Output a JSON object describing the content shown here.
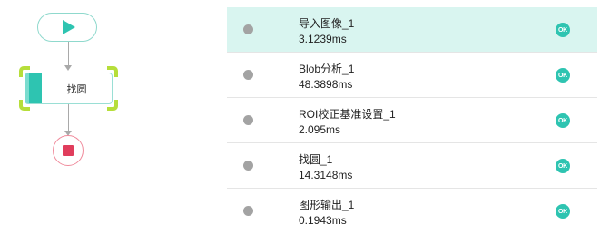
{
  "flow": {
    "start_icon": "play-icon",
    "tool_node": {
      "label": "找圆"
    },
    "end_icon": "stop-icon",
    "accent_color": "#2ec4b1",
    "selection_color": "#b6de3a",
    "stop_color": "#e03d5c"
  },
  "run_list": {
    "items": [
      {
        "name": "导入图像_1",
        "time": "3.1239ms",
        "status": "OK",
        "selected": true
      },
      {
        "name": "Blob分析_1",
        "time": "48.3898ms",
        "status": "OK",
        "selected": false
      },
      {
        "name": "ROI校正基准设置_1",
        "time": "2.095ms",
        "status": "OK",
        "selected": false
      },
      {
        "name": "找圆_1",
        "time": "14.3148ms",
        "status": "OK",
        "selected": false
      },
      {
        "name": "图形输出_1",
        "time": "0.1943ms",
        "status": "OK",
        "selected": false
      }
    ],
    "ok_color": "#2ec4b1",
    "selected_bg": "#d9f5f0"
  }
}
